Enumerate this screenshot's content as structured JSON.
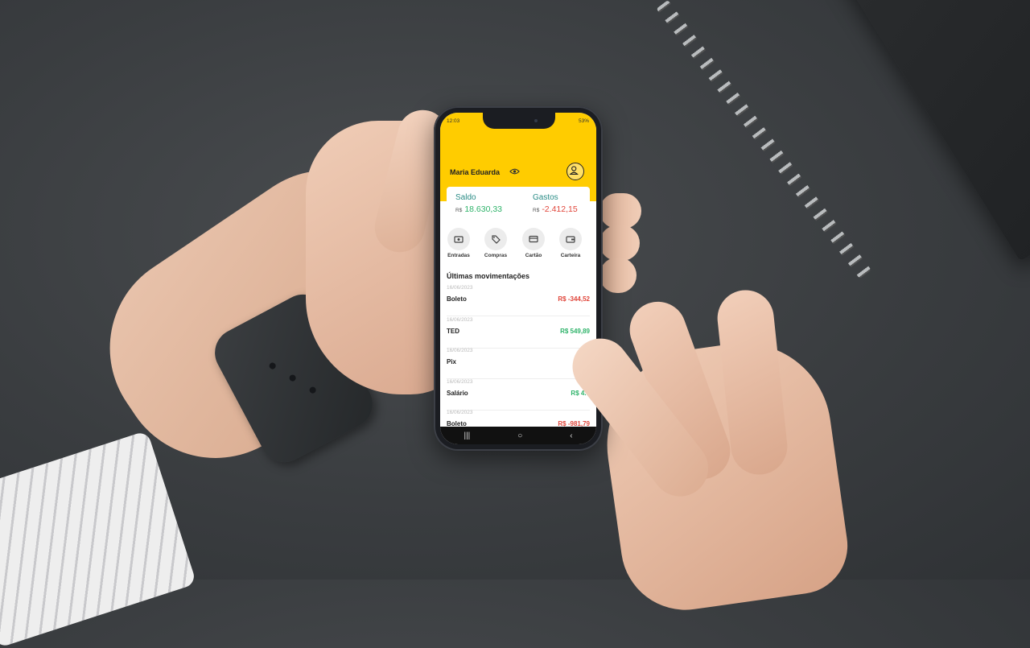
{
  "status_bar": {
    "time": "12:03",
    "battery": "53%"
  },
  "header": {
    "user_name": "Maria Eduarda"
  },
  "summary": {
    "balance_label": "Saldo",
    "balance_currency": "R$",
    "balance_value": "18.630,33",
    "expenses_label": "Gastos",
    "expenses_currency": "R$",
    "expenses_value": "-2.412,15"
  },
  "actions": [
    {
      "label": "Entradas",
      "icon": "money-in-icon"
    },
    {
      "label": "Compras",
      "icon": "tag-icon"
    },
    {
      "label": "Cartão",
      "icon": "card-icon"
    },
    {
      "label": "Carteira",
      "icon": "wallet-icon"
    }
  ],
  "transactions_title": "Últimas movimentações",
  "transactions": [
    {
      "date": "16/06/2023",
      "name": "Boleto",
      "amount": "R$ -344,52",
      "type": "debit"
    },
    {
      "date": "16/06/2023",
      "name": "TED",
      "amount": "R$ 549,89",
      "type": "credit"
    },
    {
      "date": "16/06/2023",
      "name": "Pix",
      "amount": "",
      "type": "debit"
    },
    {
      "date": "16/06/2023",
      "name": "Salário",
      "amount": "R$ 4.0",
      "type": "credit"
    },
    {
      "date": "16/06/2023",
      "name": "Boleto",
      "amount": "R$ -981,79",
      "type": "debit"
    }
  ],
  "colors": {
    "brand_yellow": "#ffcc00",
    "credit": "#2fb36a",
    "debit": "#e0453a",
    "label_teal": "#2a8c86"
  },
  "nav": {
    "recents": "|||",
    "home": "○",
    "back": "‹"
  }
}
